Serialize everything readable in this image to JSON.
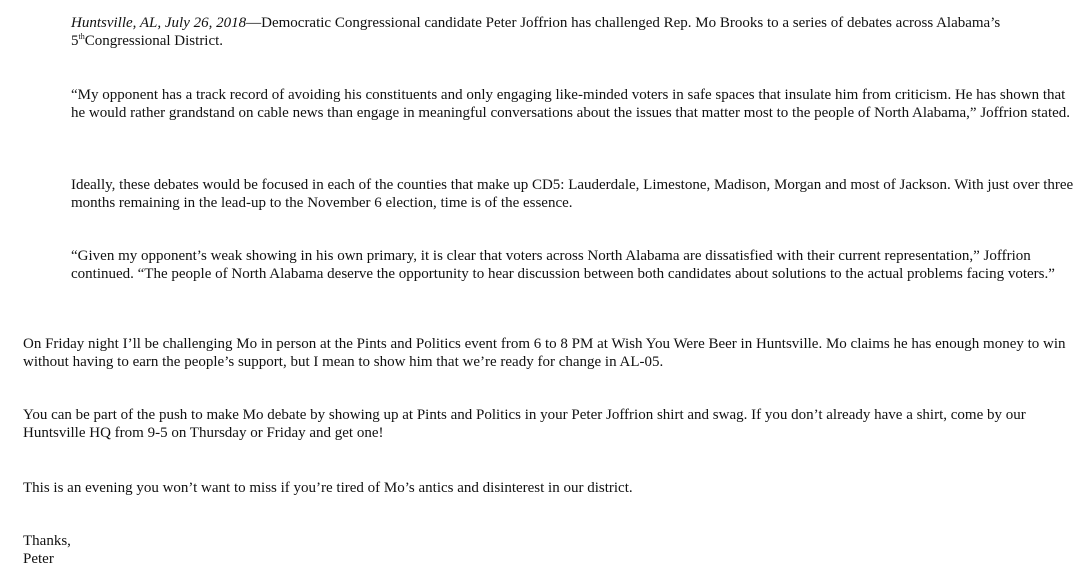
{
  "press_release": {
    "dateline": "Huntsville, AL, July 26, 2018",
    "lead_before_sup": "—Democratic Congressional candidate Peter Joffrion has challenged Rep. Mo Brooks to a series of debates across Alabama’s 5",
    "lead_sup": "th",
    "lead_after_sup": "Congressional District.",
    "quote1": "“My opponent has a track record of avoiding his constituents and only engaging like-minded voters in safe spaces that insulate him from criticism. He has shown that he would rather grandstand on cable news than engage in meaningful conversations about the issues that matter most to the people of North Alabama,” Joffrion stated.",
    "paragraph_counties": "Ideally, these debates would be focused in each of the counties that make up CD5: Lauderdale, Limestone, Madison, Morgan and most of Jackson. With just over three months remaining in the lead-up to the November 6 election, time is of the essence.",
    "quote2": "“Given my opponent’s weak showing in his own primary, it is clear that voters across North Alabama are dissatisfied with their current representation,” Joffrion continued. “The people of North Alabama deserve the opportunity to hear discussion between both candidates about solutions to the actual problems facing voters.”"
  },
  "email_body": {
    "paragraph_friday": "On Friday night I’ll be challenging Mo in person at the Pints and Politics event from 6 to 8 PM at Wish You Were Beer in Huntsville. Mo claims he has enough money to win without having to earn the people’s support, but I mean to show him that we’re ready for change in AL-05.",
    "paragraph_push": "You can be part of the push to make Mo debate by showing up at Pints and Politics in your Peter Joffrion shirt and swag. If you don’t already have a shirt, come by our Huntsville HQ from 9-5 on Thursday or Friday and get one!",
    "paragraph_evening": "This is an evening you won’t want to miss if you’re tired of Mo’s antics and disinterest in our district.",
    "signoff": "Thanks,",
    "signature": "Peter"
  }
}
